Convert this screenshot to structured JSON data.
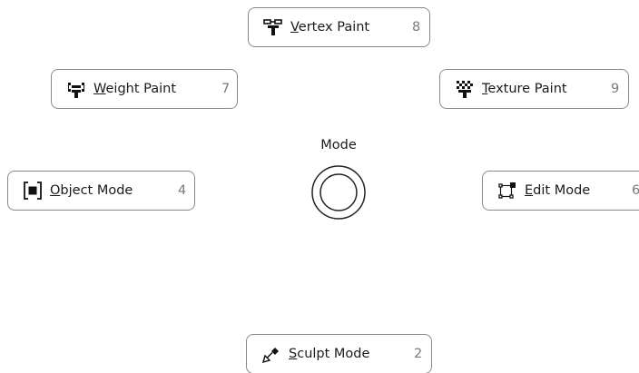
{
  "pie": {
    "title": "Mode",
    "items": [
      {
        "id": "vertex-paint",
        "mnemonic": "V",
        "rest": "ertex Paint",
        "shortcut": "8",
        "icon": "vertex-paint-icon"
      },
      {
        "id": "weight-paint",
        "mnemonic": "W",
        "rest": "eight Paint",
        "shortcut": "7",
        "icon": "weight-paint-icon"
      },
      {
        "id": "texture-paint",
        "mnemonic": "T",
        "rest": "exture Paint",
        "shortcut": "9",
        "icon": "texture-paint-icon"
      },
      {
        "id": "object-mode",
        "mnemonic": "O",
        "rest": "bject Mode",
        "shortcut": "4",
        "icon": "object-mode-icon"
      },
      {
        "id": "edit-mode",
        "mnemonic": "E",
        "rest": "dit Mode",
        "shortcut": "6",
        "icon": "edit-mode-icon"
      },
      {
        "id": "sculpt-mode",
        "mnemonic": "S",
        "rest": "culpt Mode",
        "shortcut": "2",
        "icon": "sculpt-mode-icon"
      }
    ]
  }
}
